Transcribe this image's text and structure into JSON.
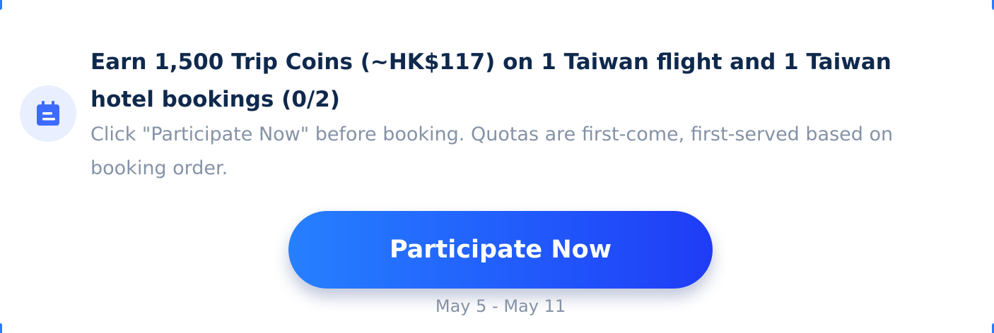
{
  "task": {
    "icon": "calendar-icon",
    "title": "Earn 1,500 Trip Coins (~HK$117) on 1 Taiwan flight and 1 Taiwan hotel bookings (0/2)",
    "description": "Click \"Participate Now\" before booking. Quotas are first-come, first-served based on booking order.",
    "progress": {
      "completed": 0,
      "total": 2
    }
  },
  "cta": {
    "label": "Participate Now"
  },
  "period": {
    "date_range": "May 5 - May 11"
  },
  "colors": {
    "title": "#0f294d",
    "secondary_text": "#8592a6",
    "icon_background": "#e9efff",
    "icon": "#3e6bff",
    "button_gradient_start": "#2680ff",
    "button_gradient_end": "#1f3cf6",
    "button_text": "#ffffff"
  }
}
